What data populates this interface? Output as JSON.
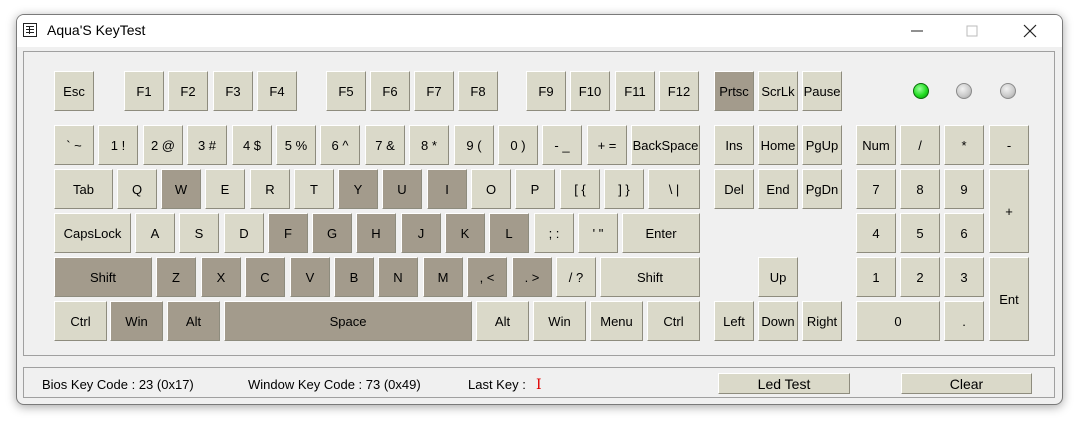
{
  "window": {
    "title": "Aqua'S KeyTest"
  },
  "titlebar_icons": {
    "app": "keyboard-app-icon",
    "minimize": "minimize-icon",
    "maximize": "maximize-icon",
    "close": "close-icon"
  },
  "colors": {
    "key_face": "#dad9c9",
    "key_pressed": "#a39b8c",
    "led_on": "#22dd22",
    "led_off": "#c8c8c8",
    "last_key_mark": "#e00000"
  },
  "keys": {
    "esc": "Esc",
    "f1": "F1",
    "f2": "F2",
    "f3": "F3",
    "f4": "F4",
    "f5": "F5",
    "f6": "F6",
    "f7": "F7",
    "f8": "F8",
    "f9": "F9",
    "f10": "F10",
    "f11": "F11",
    "f12": "F12",
    "prtsc": "Prtsc",
    "scrlk": "ScrLk",
    "pause": "Pause",
    "backtick": "` ~",
    "k1": "1 !",
    "k2": "2 @",
    "k3": "3 #",
    "k4": "4 $",
    "k5": "5 %",
    "k6": "6 ^",
    "k7": "7 &",
    "k8": "8 *",
    "k9": "9 (",
    "k0": "0 )",
    "minus": "- _",
    "equals": "+ =",
    "backspace": "BackSpace",
    "ins": "Ins",
    "home": "Home",
    "pgup": "PgUp",
    "num": "Num",
    "npslash": "/",
    "npstar": "*",
    "npminus": "-",
    "tab": "Tab",
    "q": "Q",
    "w": "W",
    "e": "E",
    "r": "R",
    "t": "T",
    "y": "Y",
    "u": "U",
    "i": "I",
    "o": "O",
    "p": "P",
    "lbracket": "[ {",
    "rbracket": "] }",
    "backslash": "\\ |",
    "del": "Del",
    "end": "End",
    "pgdn": "PgDn",
    "np7": "7",
    "np8": "8",
    "np9": "9",
    "npplus": "+",
    "capslock": "CapsLock",
    "a": "A",
    "s": "S",
    "d": "D",
    "f": "F",
    "g": "G",
    "h": "H",
    "j": "J",
    "k": "K",
    "l": "L",
    "semicolon": "; :",
    "quote": "' \"",
    "enter": "Enter",
    "np4": "4",
    "np5": "5",
    "np6": "6",
    "lshift": "Shift",
    "z": "Z",
    "x": "X",
    "c": "C",
    "v": "V",
    "b": "B",
    "n": "N",
    "m": "M",
    "comma": ", <",
    "period": ". >",
    "slash": "/ ?",
    "rshift": "Shift",
    "up": "Up",
    "np1": "1",
    "np2": "2",
    "np3": "3",
    "npent": "Ent",
    "lctrl": "Ctrl",
    "lwin": "Win",
    "lalt": "Alt",
    "space": "Space",
    "ralt": "Alt",
    "rwin": "Win",
    "menu": "Menu",
    "rctrl": "Ctrl",
    "left": "Left",
    "down": "Down",
    "right": "Right",
    "np0": "0",
    "npdot": "."
  },
  "pressed": [
    "prtsc",
    "w",
    "y",
    "u",
    "i",
    "f",
    "g",
    "h",
    "j",
    "k",
    "l",
    "lshift",
    "z",
    "x",
    "c",
    "v",
    "b",
    "n",
    "m",
    "comma",
    "period",
    "lwin",
    "lalt",
    "space"
  ],
  "leds": [
    {
      "name": "led-num-lock",
      "state": "on"
    },
    {
      "name": "led-caps-lock",
      "state": "off"
    },
    {
      "name": "led-scroll-lock",
      "state": "off"
    }
  ],
  "status": {
    "bios_key_code": "Bios Key Code : 23 (0x17)",
    "window_key_code": "Window Key Code : 73 (0x49)",
    "last_key_label": "Last Key :",
    "last_key_value": "I"
  },
  "buttons": {
    "led_test": "Led Test",
    "clear": "Clear"
  }
}
